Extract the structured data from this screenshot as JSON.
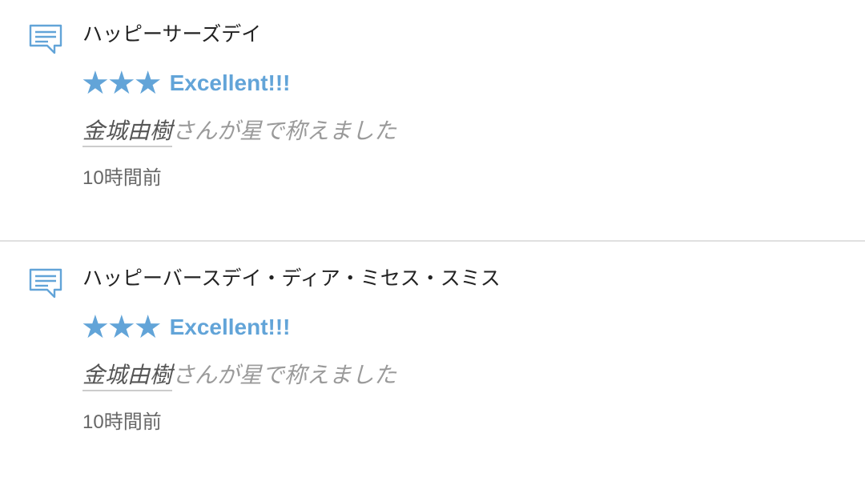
{
  "colors": {
    "accent": "#62a4d8",
    "divider": "#e0e0e0",
    "muted_text": "#9a9a9a"
  },
  "notifications": [
    {
      "icon": "comment-icon",
      "title": "ハッピーサーズデイ",
      "rating": {
        "stars": "★★★",
        "star_count": 3,
        "label": "Excellent!!!"
      },
      "user_name": "金城由樹",
      "praise_suffix": "さんが星で称えました",
      "time_ago": "10時間前"
    },
    {
      "icon": "comment-icon",
      "title": "ハッピーバースデイ・ディア・ミセス・スミス",
      "rating": {
        "stars": "★★★",
        "star_count": 3,
        "label": "Excellent!!!"
      },
      "user_name": "金城由樹",
      "praise_suffix": "さんが星で称えました",
      "time_ago": "10時間前"
    }
  ]
}
